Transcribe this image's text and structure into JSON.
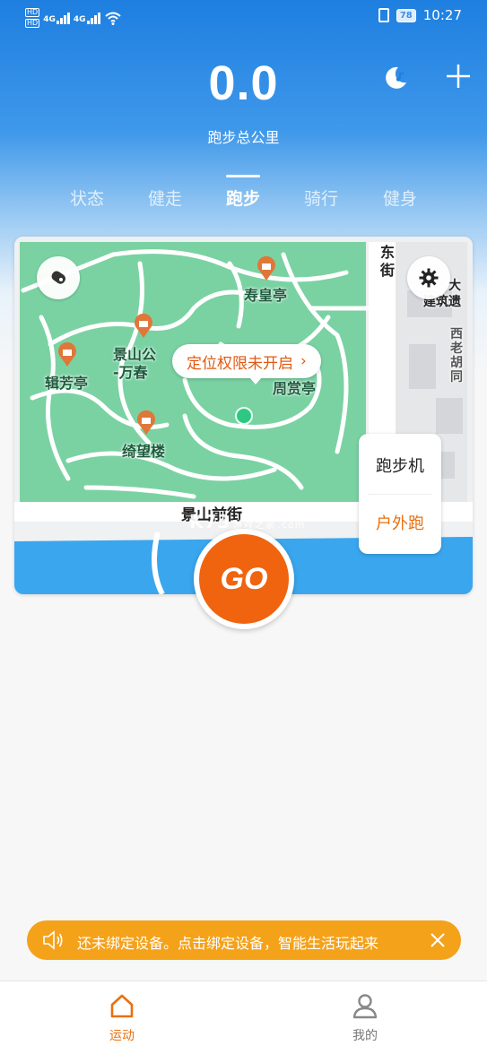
{
  "status_bar": {
    "time": "10:27",
    "battery": "78",
    "hd1": "HD",
    "hd2": "HD",
    "net1": "4G",
    "net2": "4G",
    "icons": [
      "signal-icon",
      "wifi-icon",
      "vibrate-icon",
      "battery-icon"
    ]
  },
  "header": {
    "total_value": "0.0",
    "total_label": "跑步总公里",
    "moon_icon": "moon-music-icon",
    "plus_icon": "plus-icon"
  },
  "tabs": [
    {
      "label": "状态"
    },
    {
      "label": "健走"
    },
    {
      "label": "跑步"
    },
    {
      "label": "骑行"
    },
    {
      "label": "健身"
    }
  ],
  "active_tab": "跑步",
  "map": {
    "pois": [
      {
        "label": "寿皇亭"
      },
      {
        "label": "景山公"
      },
      {
        "label": "-万春"
      },
      {
        "label": "辑芳亭"
      },
      {
        "label": "周赏亭"
      },
      {
        "label": "绮望楼"
      }
    ],
    "streets": {
      "front_street": "景山前街",
      "east1": "东",
      "east2": "街",
      "west_old1": "西",
      "west_old2": "老",
      "west_old3": "胡",
      "west_old4": "同",
      "right_top1": "大",
      "right_top2": "建筑遗"
    },
    "permission_prompt": "定位权限未开启",
    "permission_chevron": "›",
    "watermark": "K73",
    "watermark_sub": "游戏之家",
    "watermark_sub2": ".com",
    "mode_panel": {
      "treadmill": "跑步机",
      "outdoor": "户外跑"
    },
    "colors": {
      "park_green": "#7ad2a3",
      "road": "#ffffff",
      "water": "#3aa6ee",
      "poi": "#e0773a"
    }
  },
  "go_button": "GO",
  "notice": {
    "text": "还未绑定设备。点击绑定设备，智能生活玩起来",
    "color": "#f5a21b"
  },
  "bottom_nav": [
    {
      "label": "运动",
      "icon": "home-icon",
      "active": true
    },
    {
      "label": "我的",
      "icon": "person-icon",
      "active": false
    }
  ],
  "accent_color": "#e8700e"
}
